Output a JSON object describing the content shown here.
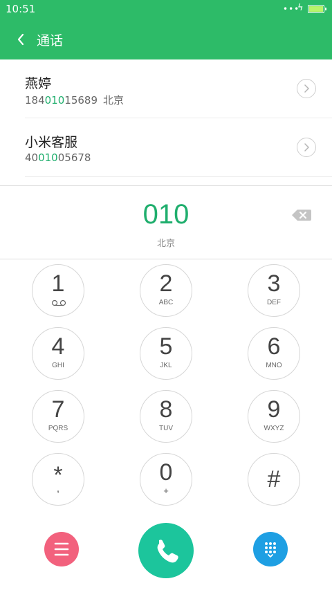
{
  "status_bar": {
    "time": "10:51",
    "signal_dots": "•••",
    "charging": "ϟ"
  },
  "header": {
    "title": "通话"
  },
  "results": [
    {
      "name": "燕婷",
      "number_pre": "184",
      "number_match": "010",
      "number_post": "15689",
      "location": "北京"
    },
    {
      "name": "小米客服",
      "number_pre": "40",
      "number_match": "010",
      "number_post": "05678",
      "location": ""
    }
  ],
  "dialer": {
    "number": "010",
    "location": "北京"
  },
  "keypad": [
    {
      "digit": "1",
      "letters": ""
    },
    {
      "digit": "2",
      "letters": "ABC"
    },
    {
      "digit": "3",
      "letters": "DEF"
    },
    {
      "digit": "4",
      "letters": "GHI"
    },
    {
      "digit": "5",
      "letters": "JKL"
    },
    {
      "digit": "6",
      "letters": "MNO"
    },
    {
      "digit": "7",
      "letters": "PQRS"
    },
    {
      "digit": "8",
      "letters": "TUV"
    },
    {
      "digit": "9",
      "letters": "WXYZ"
    },
    {
      "digit": "*",
      "letters": ","
    },
    {
      "digit": "0",
      "letters": "+"
    },
    {
      "digit": "#",
      "letters": ""
    }
  ],
  "colors": {
    "accent": "#2dbb68",
    "match": "#1fae6d",
    "menu": "#f2617d",
    "call": "#1cc59c",
    "dialpad": "#1e9fe3"
  },
  "icons": {
    "back": "chevron-left-icon",
    "detail": "chevron-right-icon",
    "voicemail": "voicemail-icon",
    "backspace": "backspace-icon",
    "menu": "menu-icon",
    "call": "phone-icon",
    "dialpad": "dialpad-icon"
  }
}
